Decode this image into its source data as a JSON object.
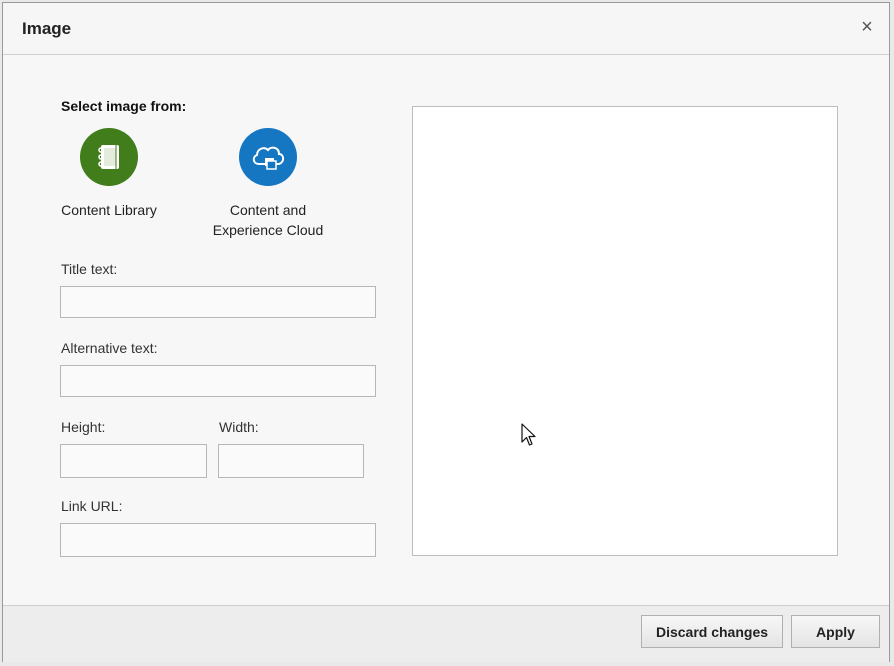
{
  "dialog": {
    "title": "Image",
    "close_symbol": "×"
  },
  "select_image": {
    "label": "Select image from:",
    "sources": [
      {
        "label": "Content Library",
        "icon": "notebook-icon",
        "color": "#417d1a"
      },
      {
        "label": "Content and Experience Cloud",
        "label_line1": "Content and",
        "label_line2": "Experience Cloud",
        "icon": "cloud-icon",
        "color": "#1576c2"
      }
    ]
  },
  "fields": {
    "title_text": {
      "label": "Title text:",
      "value": ""
    },
    "alternative_text": {
      "label": "Alternative text:",
      "value": ""
    },
    "height": {
      "label": "Height:",
      "value": ""
    },
    "width": {
      "label": "Width:",
      "value": ""
    },
    "link_url": {
      "label": "Link URL:",
      "value": ""
    }
  },
  "footer": {
    "discard_label": "Discard changes",
    "apply_label": "Apply"
  }
}
